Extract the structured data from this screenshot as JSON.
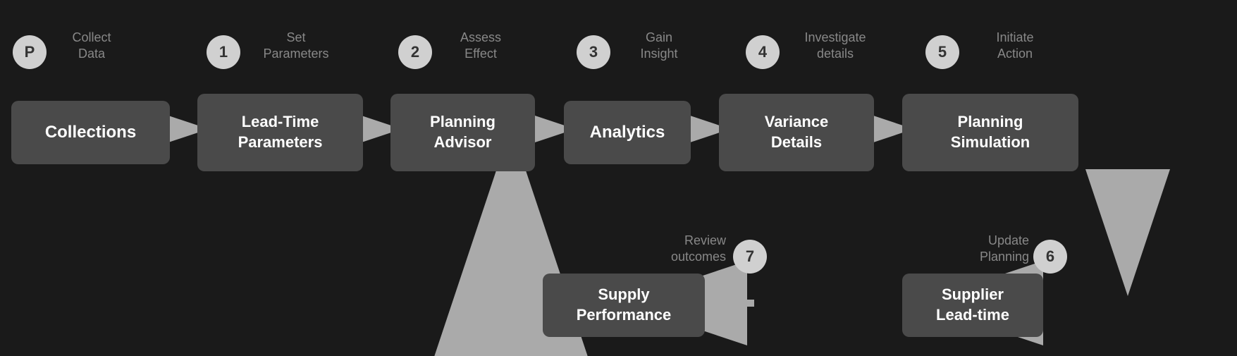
{
  "steps": {
    "p": {
      "badge": "P",
      "label": "Collect\nData",
      "label_lines": [
        "Collect",
        "Data"
      ]
    },
    "s1": {
      "badge": "1",
      "label_lines": [
        "Set",
        "Parameters"
      ]
    },
    "s2": {
      "badge": "2",
      "label_lines": [
        "Assess",
        "Effect"
      ]
    },
    "s3": {
      "badge": "3",
      "label_lines": [
        "Gain",
        "Insight"
      ]
    },
    "s4": {
      "badge": "4",
      "label_lines": [
        "Investigate",
        "details"
      ]
    },
    "s5": {
      "badge": "5",
      "label_lines": [
        "Initiate",
        "Action"
      ]
    },
    "s6": {
      "badge": "6",
      "label_lines": [
        "Update",
        "Planning"
      ]
    },
    "s7": {
      "badge": "7",
      "label_lines": [
        "Review",
        "outcomes"
      ]
    }
  },
  "nodes": {
    "collections": "Collections",
    "leadtime_params": "Lead-Time\nParameters",
    "planning_advisor": "Planning\nAdvisor",
    "analytics": "Analytics",
    "variance_details": "Variance\nDetails",
    "planning_simulation": "Planning\nSimulation",
    "supply_performance": "Supply\nPerformance",
    "supplier_leadtime": "Supplier\nLead-time"
  },
  "colors": {
    "box_bg": "#4a4a4a",
    "badge_bg": "#d0d0d0",
    "arrow_color": "#aaa",
    "label_color": "#888"
  }
}
